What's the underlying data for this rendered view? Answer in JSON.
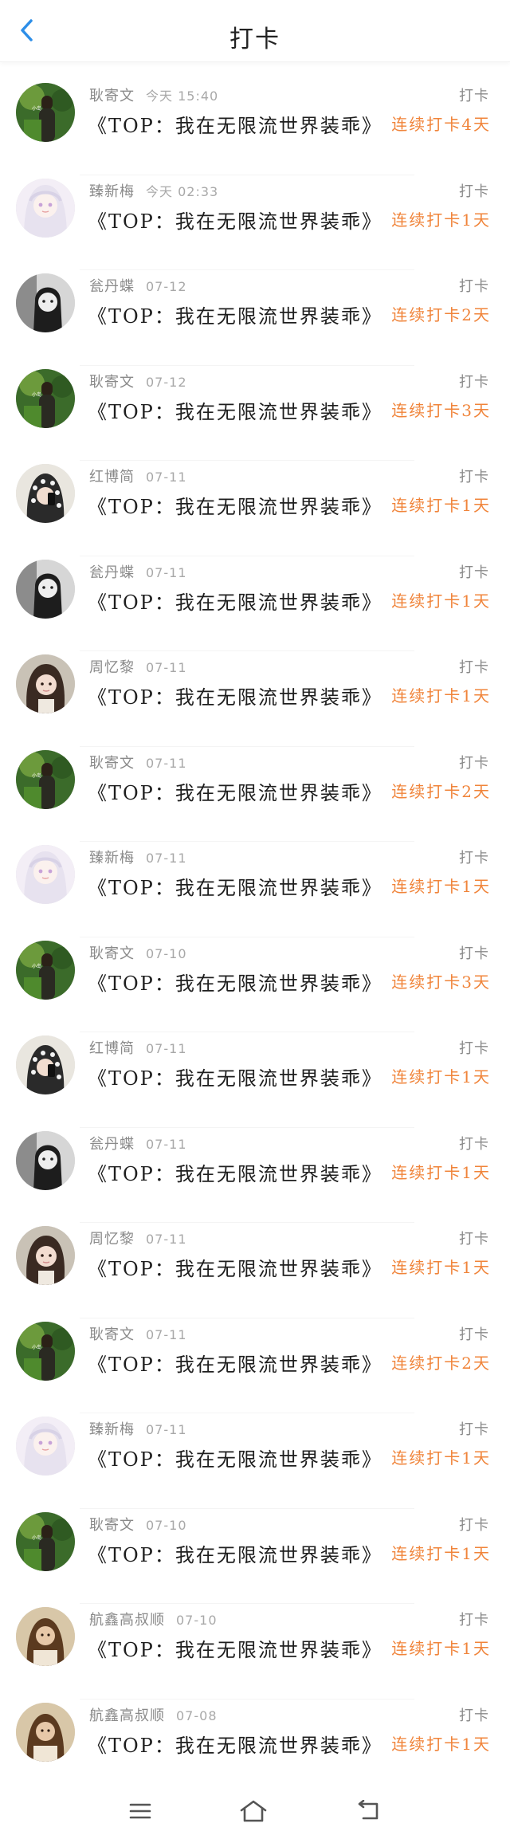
{
  "header": {
    "title": "打卡"
  },
  "colors": {
    "accent": "#f0843a",
    "back": "#2d8ee8"
  },
  "icons": {
    "back": "chevron-left-icon",
    "menu": "menu-icon",
    "home": "home-icon",
    "return": "back-arrow-icon"
  },
  "items": [
    {
      "name": "耿寄文",
      "time": "今天 15:40",
      "book": "《TOP：我在无限流世界装乖》",
      "checkin": "打卡",
      "streak": "连续打卡4天",
      "avatar": "green"
    },
    {
      "name": "臻新梅",
      "time": "今天 02:33",
      "book": "《TOP：我在无限流世界装乖》",
      "checkin": "打卡",
      "streak": "连续打卡1天",
      "avatar": "anime"
    },
    {
      "name": "瓮丹蝶",
      "time": "07-12",
      "book": "《TOP：我在无限流世界装乖》",
      "checkin": "打卡",
      "streak": "连续打卡2天",
      "avatar": "bw"
    },
    {
      "name": "耿寄文",
      "time": "07-12",
      "book": "《TOP：我在无限流世界装乖》",
      "checkin": "打卡",
      "streak": "连续打卡3天",
      "avatar": "green"
    },
    {
      "name": "红博简",
      "time": "07-11",
      "book": "《TOP：我在无限流世界装乖》",
      "checkin": "打卡",
      "streak": "连续打卡1天",
      "avatar": "hood"
    },
    {
      "name": "瓮丹蝶",
      "time": "07-11",
      "book": "《TOP：我在无限流世界装乖》",
      "checkin": "打卡",
      "streak": "连续打卡1天",
      "avatar": "bw"
    },
    {
      "name": "周忆黎",
      "time": "07-11",
      "book": "《TOP：我在无限流世界装乖》",
      "checkin": "打卡",
      "streak": "连续打卡1天",
      "avatar": "girl"
    },
    {
      "name": "耿寄文",
      "time": "07-11",
      "book": "《TOP：我在无限流世界装乖》",
      "checkin": "打卡",
      "streak": "连续打卡2天",
      "avatar": "green"
    },
    {
      "name": "臻新梅",
      "time": "07-11",
      "book": "《TOP：我在无限流世界装乖》",
      "checkin": "打卡",
      "streak": "连续打卡1天",
      "avatar": "anime"
    },
    {
      "name": "耿寄文",
      "time": "07-10",
      "book": "《TOP：我在无限流世界装乖》",
      "checkin": "打卡",
      "streak": "连续打卡3天",
      "avatar": "green"
    },
    {
      "name": "红博简",
      "time": "07-11",
      "book": "《TOP：我在无限流世界装乖》",
      "checkin": "打卡",
      "streak": "连续打卡1天",
      "avatar": "hood"
    },
    {
      "name": "瓮丹蝶",
      "time": "07-11",
      "book": "《TOP：我在无限流世界装乖》",
      "checkin": "打卡",
      "streak": "连续打卡1天",
      "avatar": "bw"
    },
    {
      "name": "周忆黎",
      "time": "07-11",
      "book": "《TOP：我在无限流世界装乖》",
      "checkin": "打卡",
      "streak": "连续打卡1天",
      "avatar": "girl"
    },
    {
      "name": "耿寄文",
      "time": "07-11",
      "book": "《TOP：我在无限流世界装乖》",
      "checkin": "打卡",
      "streak": "连续打卡2天",
      "avatar": "green"
    },
    {
      "name": "臻新梅",
      "time": "07-11",
      "book": "《TOP：我在无限流世界装乖》",
      "checkin": "打卡",
      "streak": "连续打卡1天",
      "avatar": "anime"
    },
    {
      "name": "耿寄文",
      "time": "07-10",
      "book": "《TOP：我在无限流世界装乖》",
      "checkin": "打卡",
      "streak": "连续打卡1天",
      "avatar": "green"
    },
    {
      "name": "航鑫高叔顺",
      "time": "07-10",
      "book": "《TOP：我在无限流世界装乖》",
      "checkin": "打卡",
      "streak": "连续打卡1天",
      "avatar": "brown"
    },
    {
      "name": "航鑫高叔顺",
      "time": "07-08",
      "book": "《TOP：我在无限流世界装乖》",
      "checkin": "打卡",
      "streak": "连续打卡1天",
      "avatar": "brown"
    }
  ]
}
